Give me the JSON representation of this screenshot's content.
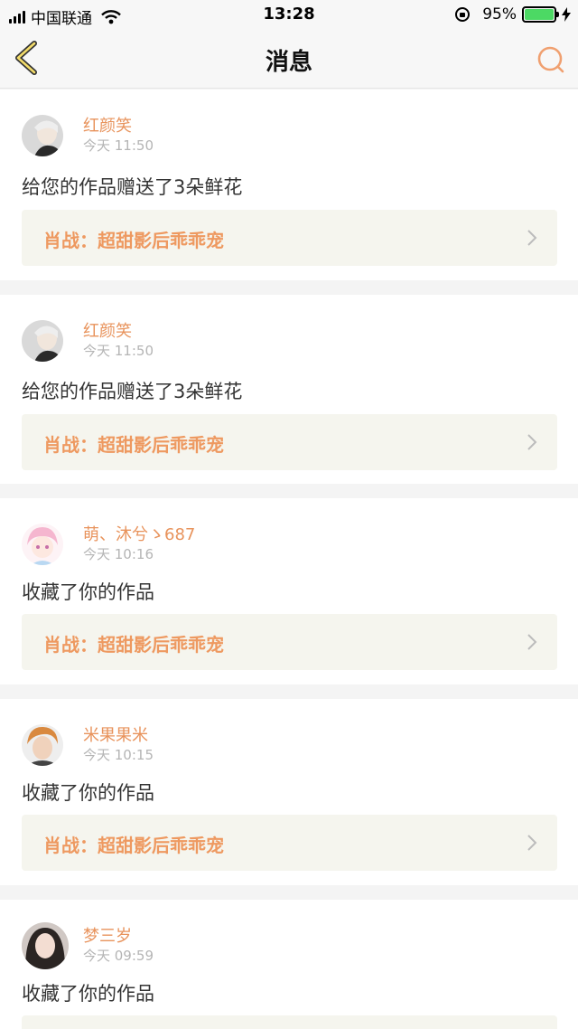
{
  "status_bar": {
    "carrier": "中国联通",
    "time": "13:28",
    "battery_pct": "95%"
  },
  "nav": {
    "title": "消息"
  },
  "messages": [
    {
      "user": "红颜笑",
      "time": "今天 11:50",
      "action": "给您的作品赠送了3朵鲜花",
      "work": "肖战：超甜影后乖乖宠"
    },
    {
      "user": "红颜笑",
      "time": "今天 11:50",
      "action": "给您的作品赠送了3朵鲜花",
      "work": "肖战：超甜影后乖乖宠"
    },
    {
      "user": "萌、沐兮ゝ687",
      "time": "今天 10:16",
      "action": "收藏了你的作品",
      "work": "肖战：超甜影后乖乖宠"
    },
    {
      "user": "米果果米",
      "time": "今天 10:15",
      "action": "收藏了你的作品",
      "work": "肖战：超甜影后乖乖宠"
    },
    {
      "user": "梦三岁",
      "time": "今天 09:59",
      "action": "收藏了你的作品",
      "work": ""
    }
  ],
  "colors": {
    "accent": "#e8935c",
    "link_bg": "#f5f5ee",
    "battery": "#4cd964"
  }
}
